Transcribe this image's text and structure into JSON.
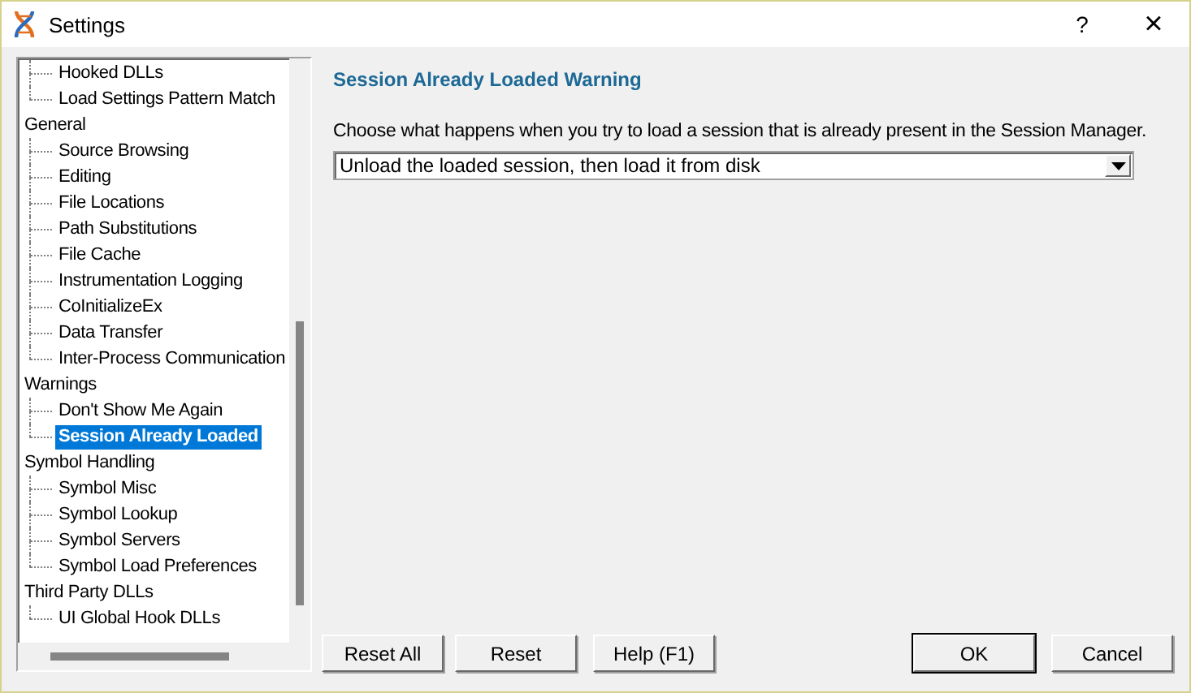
{
  "window": {
    "title": "Settings",
    "help": "?",
    "close": "×"
  },
  "tree": [
    {
      "children": [
        {
          "label": "Hooked DLLs",
          "selected": false
        },
        {
          "label": "Load Settings Pattern Match",
          "selected": false
        }
      ]
    },
    {
      "label": "General",
      "selected": false,
      "children": [
        {
          "label": "Source Browsing",
          "selected": false
        },
        {
          "label": "Editing",
          "selected": false
        },
        {
          "label": "File Locations",
          "selected": false
        },
        {
          "label": "Path Substitutions",
          "selected": false
        },
        {
          "label": "File Cache",
          "selected": false
        },
        {
          "label": "Instrumentation Logging",
          "selected": false
        },
        {
          "label": "CoInitializeEx",
          "selected": false
        },
        {
          "label": "Data Transfer",
          "selected": false
        },
        {
          "label": "Inter-Process Communication",
          "selected": false
        }
      ]
    },
    {
      "label": "Warnings",
      "selected": false,
      "children": [
        {
          "label": "Don't Show Me Again",
          "selected": false
        },
        {
          "label": "Session Already Loaded",
          "selected": true
        }
      ]
    },
    {
      "label": "Symbol Handling",
      "selected": false,
      "children": [
        {
          "label": "Symbol Misc",
          "selected": false
        },
        {
          "label": "Symbol Lookup",
          "selected": false
        },
        {
          "label": "Symbol Servers",
          "selected": false
        },
        {
          "label": "Symbol Load Preferences",
          "selected": false
        }
      ]
    },
    {
      "label": "Third Party DLLs",
      "selected": false,
      "children": [
        {
          "label": "UI Global Hook DLLs",
          "selected": false
        }
      ]
    }
  ],
  "panel": {
    "title": "Session Already Loaded Warning",
    "description": "Choose what happens when you try to load a session that is already present in the Session Manager.",
    "dropdown": {
      "value": "Unload the loaded session, then load it from disk"
    }
  },
  "buttons_left": [
    "Reset All",
    "Reset",
    "Help (F1)"
  ],
  "buttons_right": [
    {
      "label": "OK",
      "default": true
    },
    {
      "label": "Cancel",
      "default": false
    }
  ]
}
